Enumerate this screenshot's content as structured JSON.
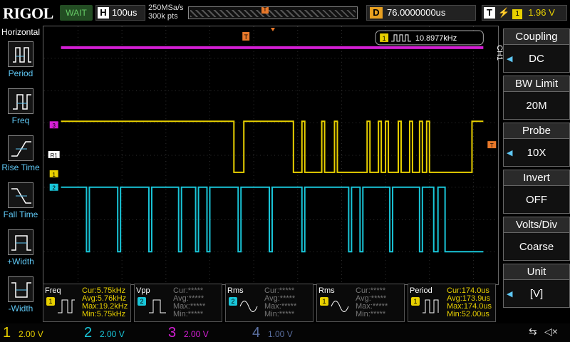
{
  "brand": {
    "name": "RIGOL"
  },
  "status": {
    "run_state": "WAIT",
    "color": "#6c6"
  },
  "horizontal": {
    "key": "H",
    "timebase": "100us",
    "sample_rate": "250MSa/s",
    "mem_depth": "300k pts"
  },
  "delay": {
    "key": "D",
    "value": "76.0000000us"
  },
  "trigger": {
    "key": "T",
    "source": "1",
    "level": "1.96 V",
    "edge_icon": "rising-edge-icon"
  },
  "left_menu": {
    "title": "Horizontal",
    "items": [
      {
        "label": "Period"
      },
      {
        "label": "Freq"
      },
      {
        "label": "Rise Time"
      },
      {
        "label": "Fall Time"
      },
      {
        "label": "+Width"
      },
      {
        "label": "-Width"
      }
    ]
  },
  "freq_counter": {
    "channel": "1",
    "value": "10.8977kHz"
  },
  "channel_markers": {
    "ch3": "3",
    "r1": "R1",
    "ch1": "1",
    "ch2": "2",
    "trig": "T"
  },
  "right_menu": {
    "channel_tag": "CH1",
    "items": [
      {
        "title": "Coupling",
        "value": "DC"
      },
      {
        "title": "BW Limit",
        "value": "20M"
      },
      {
        "title": "Probe",
        "value": "10X"
      },
      {
        "title": "Invert",
        "value": "OFF"
      },
      {
        "title": "Volts/Div",
        "value": "Coarse"
      },
      {
        "title": "Unit",
        "value": "[V]"
      }
    ]
  },
  "measurements": [
    {
      "name": "Freq",
      "channel": "1",
      "color": "#e8d000",
      "rows": [
        "Cur:5.75kHz",
        "Avg:5.76kHz",
        "Max:19.2kHz",
        "Min:5.75kHz"
      ]
    },
    {
      "name": "Vpp",
      "channel": "2",
      "color": "#19c6d9",
      "rows": [
        "Cur:*****",
        "Avg:*****",
        "Max:*****",
        "Min:*****"
      ]
    },
    {
      "name": "Rms",
      "channel": "2",
      "color": "#19c6d9",
      "rows": [
        "Cur:*****",
        "Avg:*****",
        "Max:*****",
        "Min:*****"
      ]
    },
    {
      "name": "Rms",
      "channel": "1",
      "color": "#e8d000",
      "rows": [
        "Cur:*****",
        "Avg:*****",
        "Max:*****",
        "Min:*****"
      ]
    },
    {
      "name": "Period",
      "channel": "1",
      "color": "#e8d000",
      "rows": [
        "Cur:174.0us",
        "Avg:173.9us",
        "Max:174.0us",
        "Min:52.00us"
      ]
    }
  ],
  "channels": [
    {
      "num": "1",
      "scale": "2.00 V",
      "color": "#e8d000"
    },
    {
      "num": "2",
      "scale": "2.00 V",
      "color": "#19c6d9"
    },
    {
      "num": "3",
      "scale": "2.00 V",
      "color": "#d61fd6"
    },
    {
      "num": "4",
      "scale": "1.00 V",
      "color": "#5a6fa0"
    }
  ],
  "colors": {
    "ch1": "#e8d000",
    "ch2": "#19c6d9",
    "ch3": "#d61fd6",
    "trigger": "#e8782a",
    "menu_accent": "#5fc8f5"
  },
  "icons": {
    "usb": "usb-icon",
    "speaker": "speaker-mute-icon"
  }
}
